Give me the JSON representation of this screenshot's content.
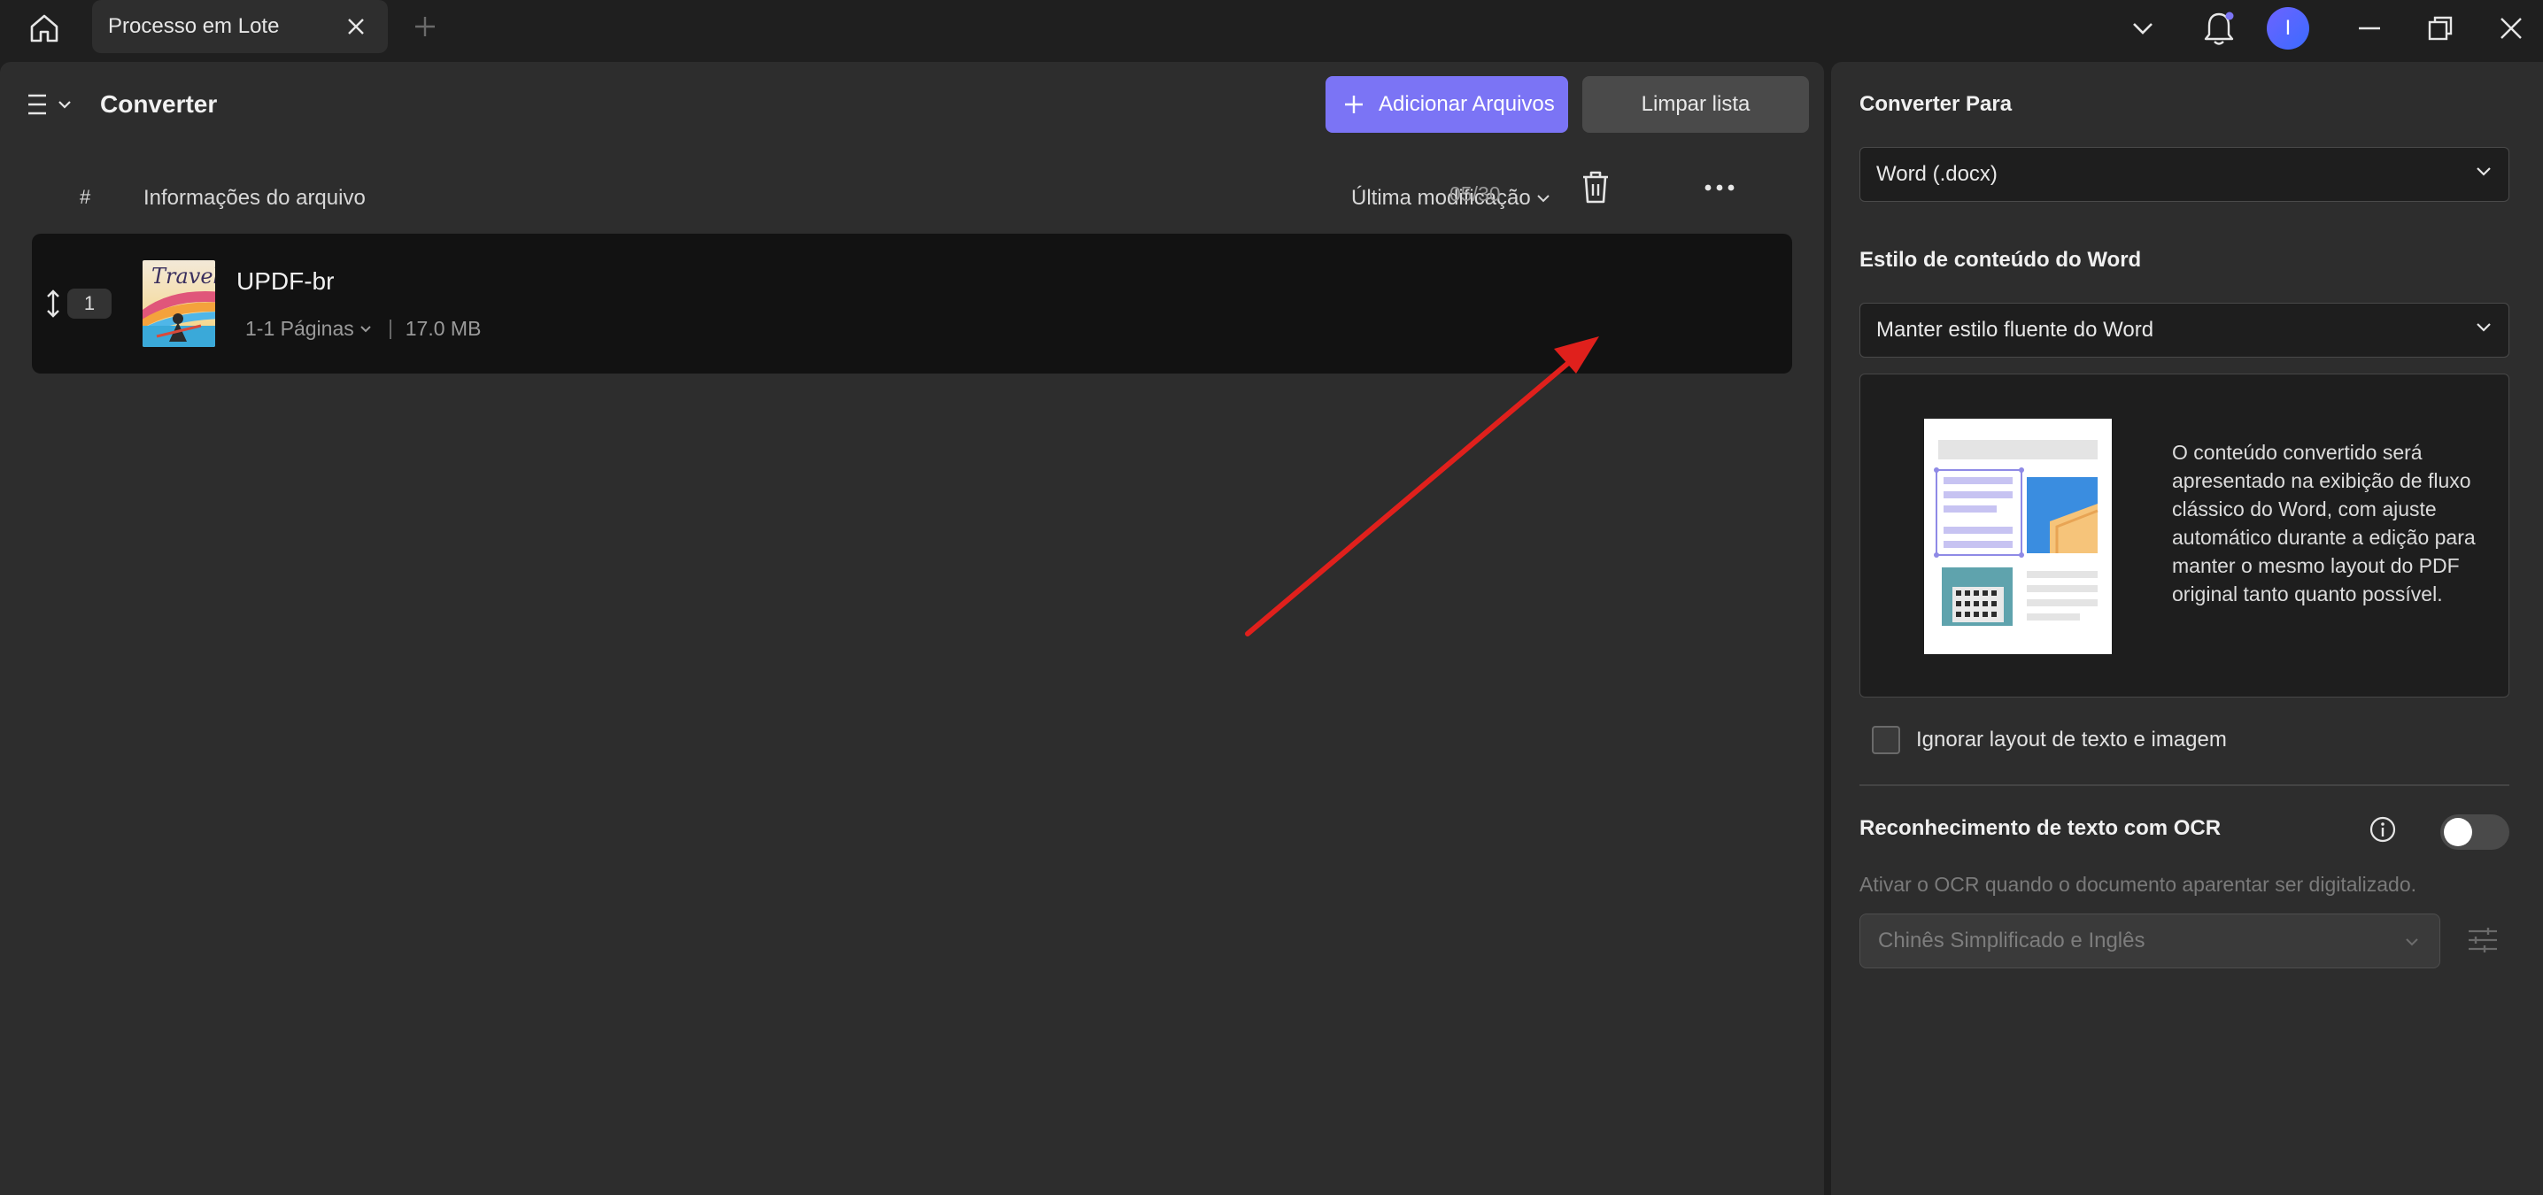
{
  "titlebar": {
    "tab_label": "Processo em Lote",
    "avatar_initial": "I",
    "icons": [
      "home-icon",
      "close-icon",
      "plus-icon",
      "chevron-down-icon",
      "bell-icon",
      "minimize-icon",
      "restore-icon",
      "close-window-icon"
    ]
  },
  "header": {
    "title": "Converter",
    "add_files_label": "Adicionar Arquivos",
    "clear_list_label": "Limpar lista"
  },
  "table": {
    "col_number": "#",
    "col_info": "Informações do arquivo",
    "col_modified": "Última modificação"
  },
  "files": [
    {
      "index": "1",
      "name": "UPDF-br",
      "thumbnail_title": "Travel",
      "pages": "1-1 Páginas",
      "size": "17.0 MB",
      "modified": "05/30"
    }
  ],
  "side": {
    "convert_to_title": "Converter Para",
    "format_value": "Word (.docx)",
    "style_title": "Estilo de conteúdo do Word",
    "style_value": "Manter estilo fluente do Word",
    "style_description": "O conteúdo convertido será apresentado na exibição de fluxo clássico do Word, com ajuste automático durante a edição para manter o mesmo layout do PDF original tanto quanto possível.",
    "ignore_layout_label": "Ignorar layout de texto e imagem",
    "ignore_layout_checked": false,
    "ocr_title": "Reconhecimento de texto com OCR",
    "ocr_enabled": false,
    "ocr_description": "Ativar o OCR quando o documento aparentar ser digitalizado.",
    "ocr_language": "Chinês Simplificado e Inglês"
  },
  "colors": {
    "accent": "#7b74f5",
    "background": "#1f1f1f",
    "panel": "#2d2d2d",
    "row": "#121212",
    "annotation_arrow": "#e0201c"
  }
}
